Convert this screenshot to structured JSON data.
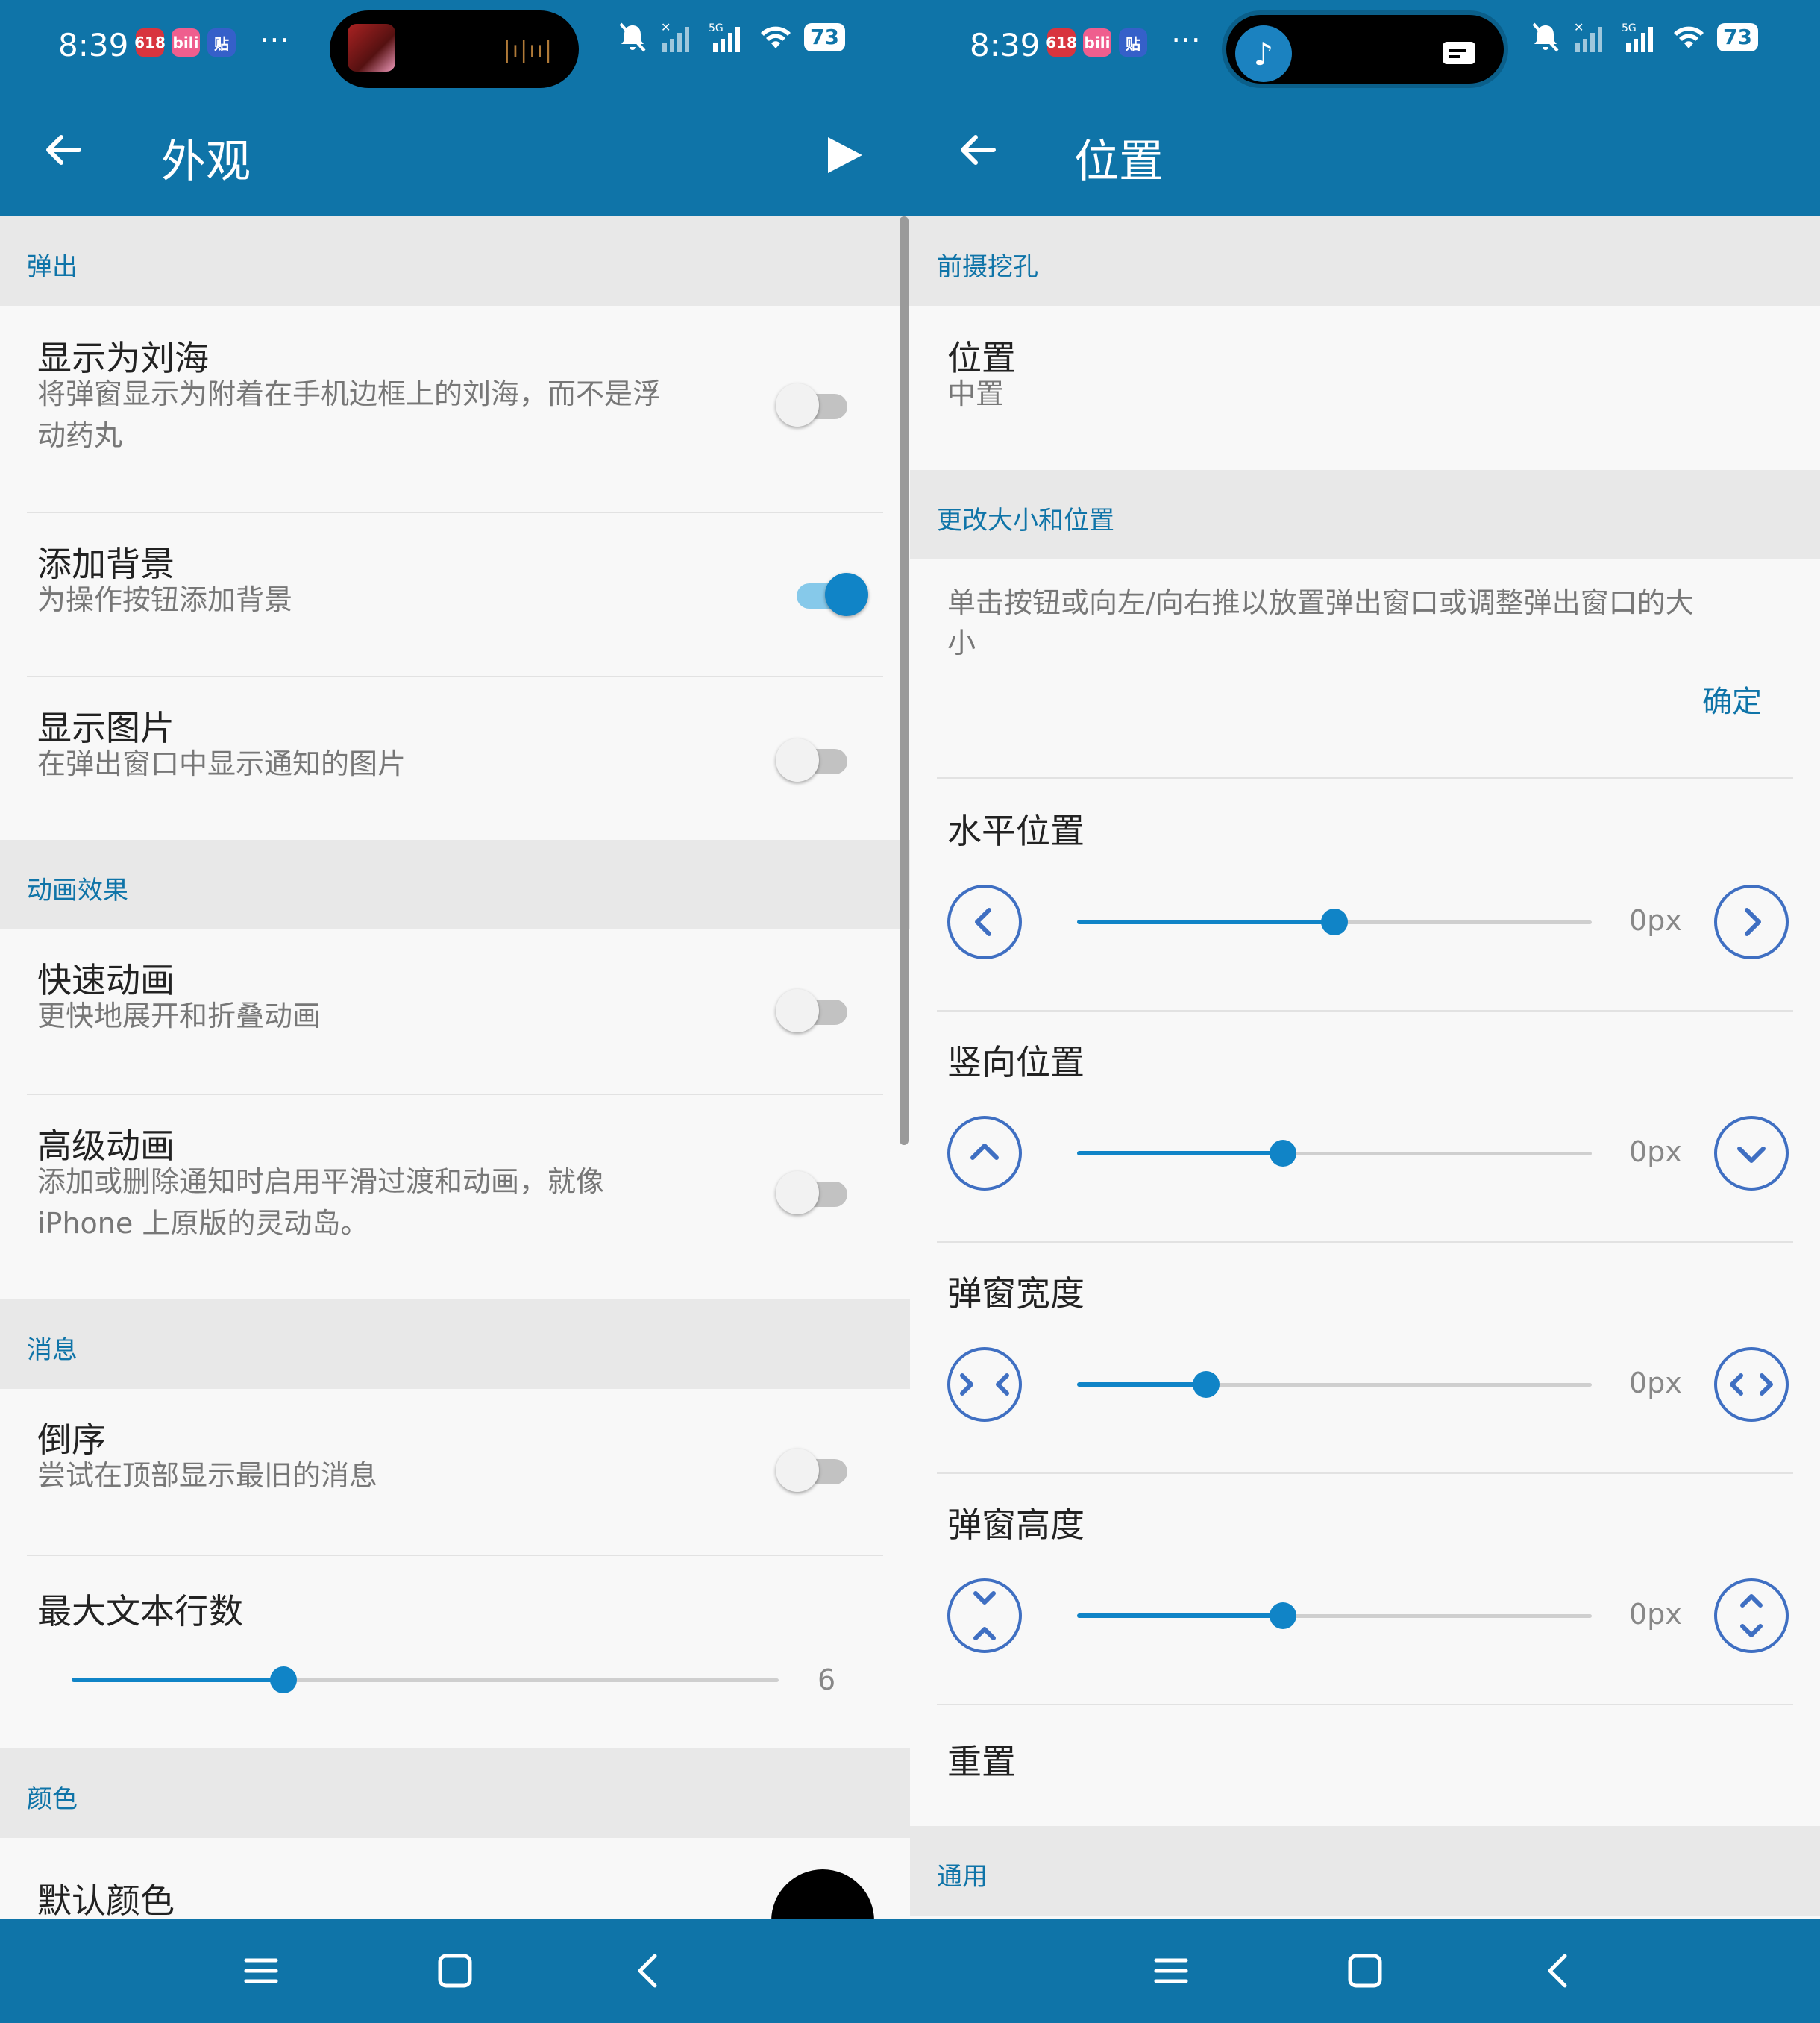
{
  "colors": {
    "primary": "#0f74a8",
    "accent": "#1084c7",
    "section_bg": "#e8e8e8",
    "page_bg": "#f8f8f8"
  },
  "status": {
    "time": "8:39",
    "app_icons": [
      "618",
      "bili",
      "贴"
    ],
    "network": "5G",
    "battery": "73",
    "icons": [
      "mute-icon",
      "signal-x-icon",
      "signal-icon",
      "wifi-icon",
      "battery-icon"
    ]
  },
  "left": {
    "title": "外观",
    "sections": [
      {
        "label": "弹出"
      },
      {
        "label": "动画效果"
      },
      {
        "label": "消息"
      },
      {
        "label": "颜色"
      }
    ],
    "rows": [
      {
        "title": "显示为刘海",
        "subtitle_lines": [
          "将弹窗显示为附着在手机边框上的刘海，而不是浮",
          "动药丸"
        ],
        "on": false
      },
      {
        "title": "添加背景",
        "subtitle_lines": [
          "为操作按钮添加背景"
        ],
        "on": true
      },
      {
        "title": "显示图片",
        "subtitle_lines": [
          "在弹出窗口中显示通知的图片"
        ],
        "on": false
      },
      {
        "title": "快速动画",
        "subtitle_lines": [
          "更快地展开和折叠动画"
        ],
        "on": false
      },
      {
        "title": "高级动画",
        "subtitle_lines": [
          "添加或删除通知时启用平滑过渡和动画，就像",
          "iPhone 上原版的灵动岛。"
        ],
        "on": false
      },
      {
        "title": "倒序",
        "subtitle_lines": [
          "尝试在顶部显示最旧的消息"
        ],
        "on": false
      }
    ],
    "max_lines": {
      "title": "最大文本行数",
      "value": "6",
      "fraction": 0.3
    },
    "default_color": {
      "title": "默认颜色",
      "color": "#000000"
    }
  },
  "right": {
    "title": "位置",
    "sections": [
      {
        "label": "前摄挖孔"
      },
      {
        "label": "更改大小和位置"
      },
      {
        "label": "通用"
      }
    ],
    "position": {
      "title": "位置",
      "value": "中置"
    },
    "hint_lines": [
      "单击按钮或向左/向右推以放置弹出窗口或调整弹出窗口的大",
      "小"
    ],
    "ok_label": "确定",
    "sliders": [
      {
        "title": "水平位置",
        "value": "0px",
        "fraction": 0.5,
        "left_icon": "chevron-left-icon",
        "right_icon": "chevron-right-icon"
      },
      {
        "title": "竖向位置",
        "value": "0px",
        "fraction": 0.4,
        "left_icon": "chevron-up-icon",
        "right_icon": "chevron-down-icon"
      },
      {
        "title": "弹窗宽度",
        "value": "0px",
        "fraction": 0.25,
        "left_icon": "shrink-horizontal-icon",
        "right_icon": "expand-horizontal-icon"
      },
      {
        "title": "弹窗高度",
        "value": "0px",
        "fraction": 0.4,
        "left_icon": "shrink-vertical-icon",
        "right_icon": "expand-vertical-icon"
      }
    ],
    "reset_label": "重置"
  },
  "nav": {
    "icons": [
      "menu-icon",
      "home-icon",
      "back-icon"
    ]
  }
}
